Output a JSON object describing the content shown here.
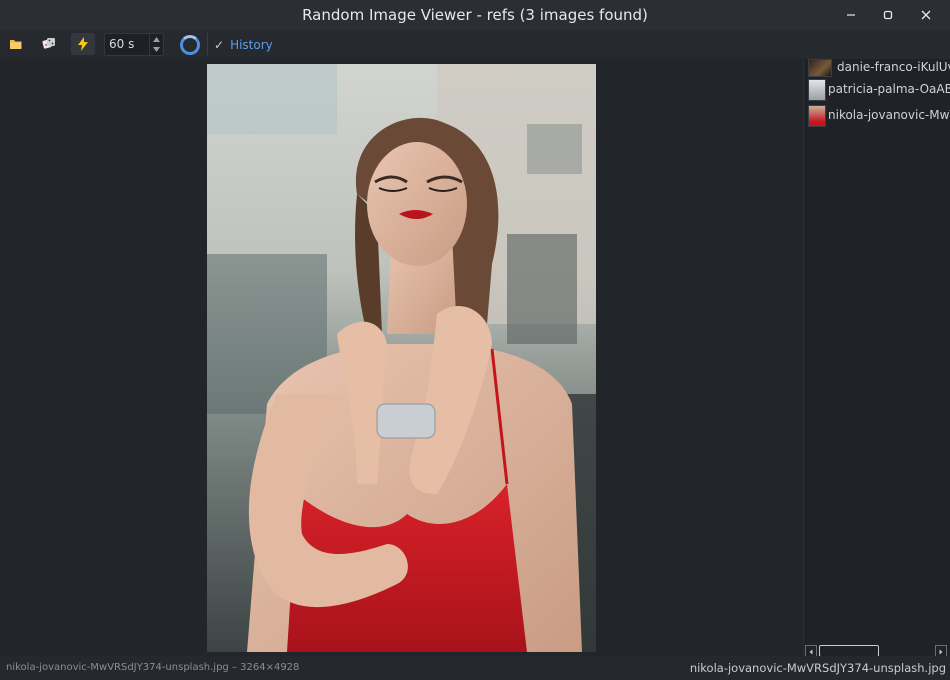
{
  "window": {
    "title": "Random Image Viewer - refs (3 images found)"
  },
  "toolbar": {
    "open_folder_icon": "folder-icon",
    "random_icon": "dice-icon",
    "auto_icon": "lightning-icon",
    "interval_value": "60 s",
    "history_check": "✓",
    "history_label": "History"
  },
  "viewer": {
    "image_subject": "woman in red dress"
  },
  "files": [
    {
      "name": "danie-franco-iKulUvN"
    },
    {
      "name": "patricia-palma-OaAB-e"
    },
    {
      "name": "nikola-jovanovic-MwV"
    }
  ],
  "status": {
    "left_text": "nikola-jovanovic-MwVRSdJY374-unsplash.jpg – 3264×4928",
    "right_text": "nikola-jovanovic-MwVRSdJY374-unsplash.jpg"
  },
  "colors": {
    "accent": "#4f8fe0",
    "link": "#5e9de6",
    "dress": "#c4151d"
  }
}
